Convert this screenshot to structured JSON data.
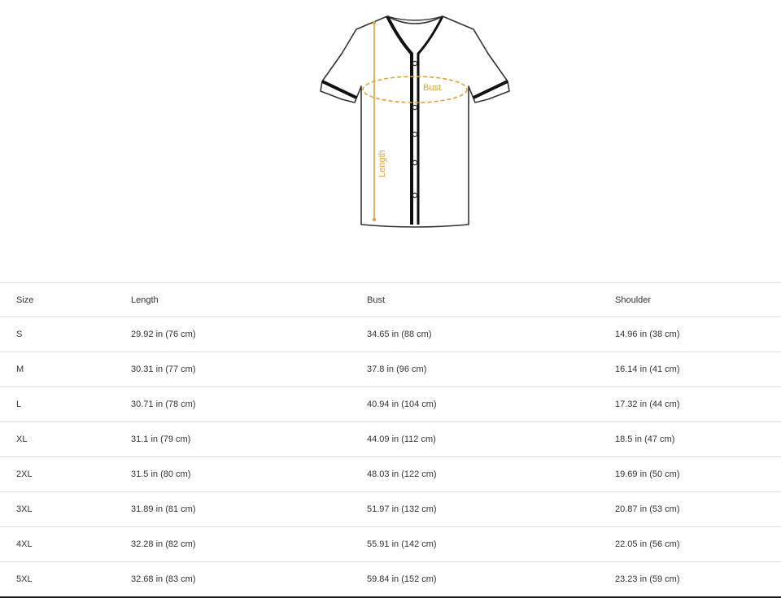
{
  "figure": {
    "labels": {
      "bust": "Bust",
      "length": "Length"
    },
    "colors": {
      "outline": "#333333",
      "trim": "#111111",
      "measure": "#e0a23a"
    }
  },
  "table": {
    "headers": [
      "Size",
      "Length",
      "Bust",
      "Shoulder"
    ],
    "rows": [
      [
        "S",
        "29.92 in  (76 cm)",
        "34.65 in  (88 cm)",
        "14.96 in  (38 cm)"
      ],
      [
        "M",
        "30.31 in  (77 cm)",
        "37.8 in  (96 cm)",
        "16.14 in  (41 cm)"
      ],
      [
        "L",
        "30.71 in  (78 cm)",
        "40.94 in  (104 cm)",
        "17.32 in  (44 cm)"
      ],
      [
        "XL",
        "31.1 in  (79 cm)",
        "44.09 in  (112 cm)",
        "18.5 in  (47 cm)"
      ],
      [
        "2XL",
        "31.5 in  (80 cm)",
        "48.03 in  (122 cm)",
        "19.69 in  (50 cm)"
      ],
      [
        "3XL",
        "31.89 in  (81 cm)",
        "51.97 in  (132 cm)",
        "20.87 in  (53 cm)"
      ],
      [
        "4XL",
        "32.28 in  (82 cm)",
        "55.91 in  (142 cm)",
        "22.05 in  (56 cm)"
      ],
      [
        "5XL",
        "32.68 in  (83 cm)",
        "59.84 in  (152 cm)",
        "23.23 in  (59 cm)"
      ]
    ]
  }
}
